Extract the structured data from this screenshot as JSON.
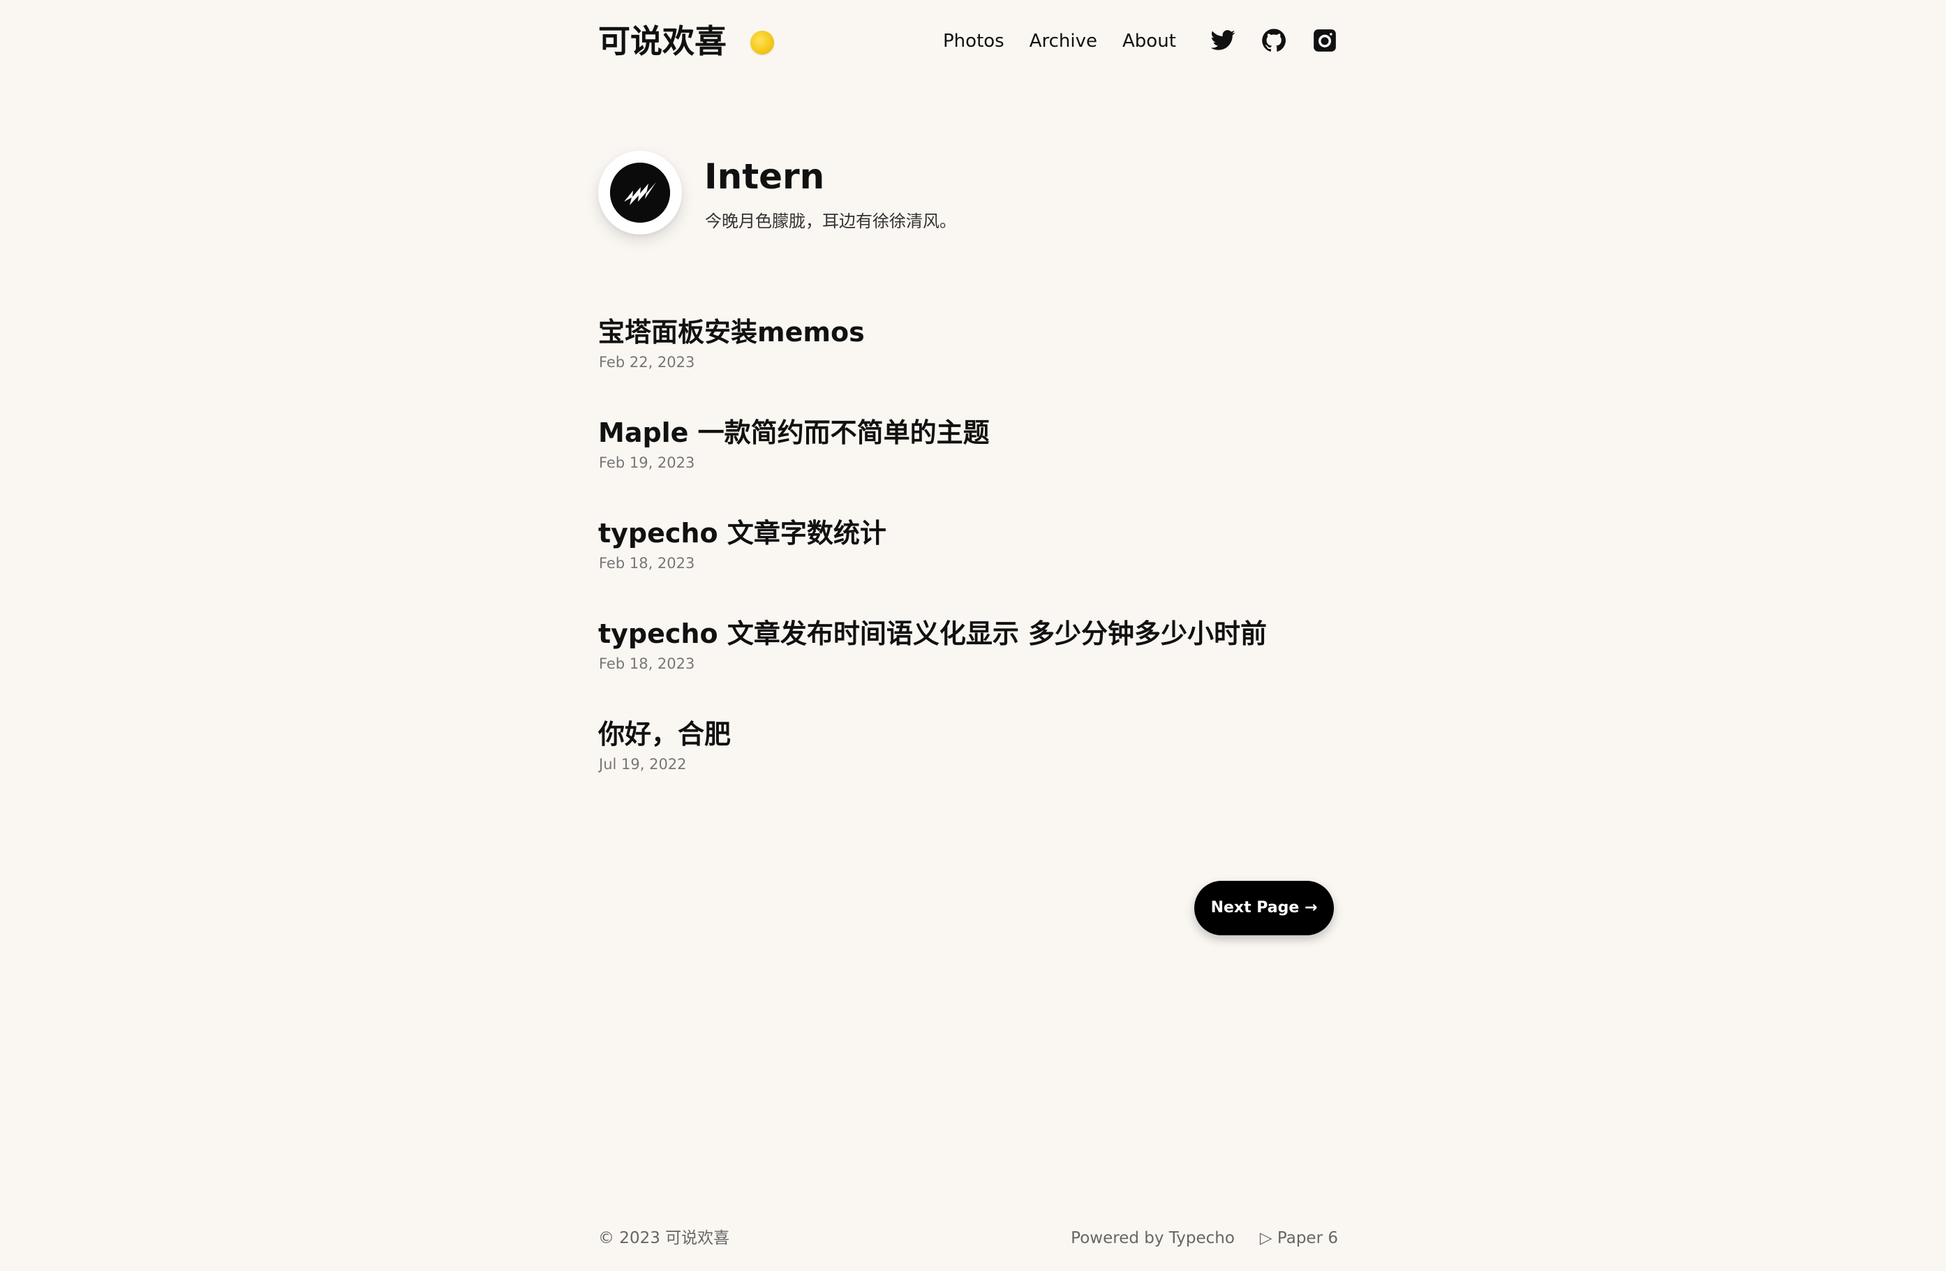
{
  "header": {
    "site_title": "可说欢喜",
    "nav": [
      {
        "label": "Photos"
      },
      {
        "label": "Archive"
      },
      {
        "label": "About"
      }
    ],
    "social_icons": [
      "twitter-icon",
      "github-icon",
      "instagram-icon"
    ],
    "toggle_color": "#f6c91a"
  },
  "profile": {
    "name": "Intern",
    "bio": "今晚月色朦胧，耳边有徐徐清风。"
  },
  "posts": [
    {
      "title": "宝塔面板安装memos",
      "date": "Feb 22, 2023"
    },
    {
      "title": "Maple 一款简约而不简单的主题",
      "date": "Feb 19, 2023"
    },
    {
      "title": "typecho 文章字数统计",
      "date": "Feb 18, 2023"
    },
    {
      "title": "typecho 文章发布时间语义化显示 多少分钟多少小时前",
      "date": "Feb 18, 2023"
    },
    {
      "title": "你好，合肥",
      "date": "Jul 19, 2022"
    }
  ],
  "pagination": {
    "next_label": "Next Page →"
  },
  "footer": {
    "copyright": "© 2023 可说欢喜",
    "powered": "Powered by Typecho",
    "theme": "▷ Paper 6"
  },
  "colors": {
    "background": "#faf7f2",
    "text": "#111111",
    "muted": "#777777",
    "button": "#000000"
  }
}
